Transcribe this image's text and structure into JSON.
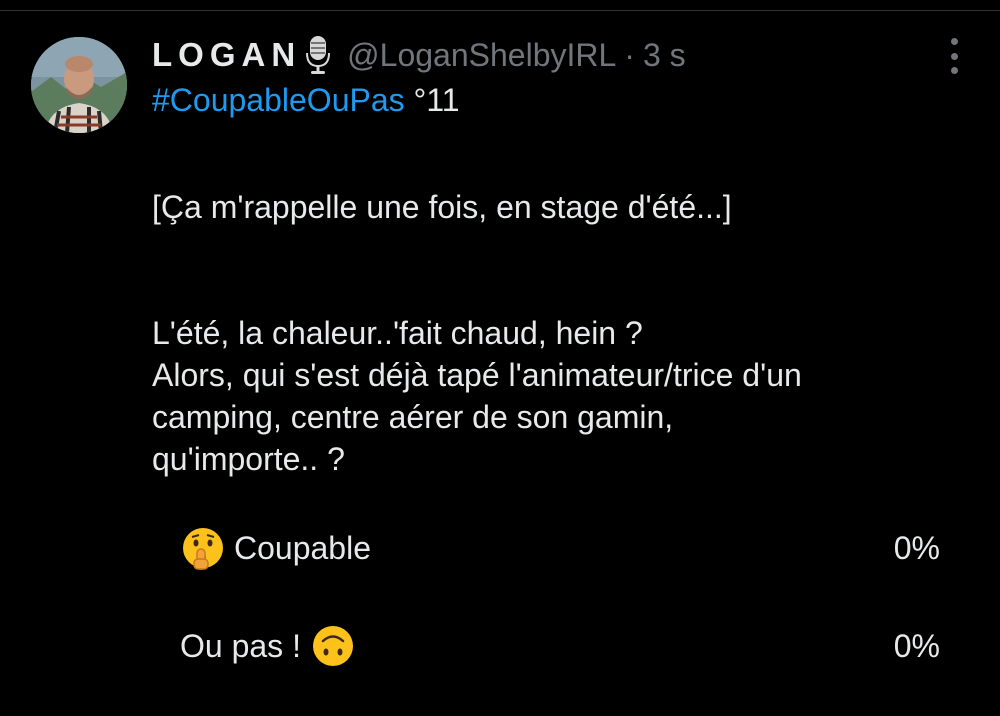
{
  "tweet": {
    "display_name": "LOGAN",
    "name_badge_icon": "microphone-icon",
    "handle": "@LoganShelbyIRL",
    "separator": "·",
    "timestamp": "3 s",
    "more_icon": "more-vertical-icon",
    "hashtag": "#CoupableOuPas",
    "hashtag_suffix": " °11",
    "body": {
      "line1": "[Ça m'rappelle une fois, en stage d'été...]",
      "line2": "L'été, la chaleur..'fait chaud, hein ?",
      "line3": "Alors, qui s'est déjà tapé l'animateur/trice d'un",
      "line4": "camping, centre aérer de son gamin,",
      "line5": "qu'importe.. ?"
    }
  },
  "poll": {
    "options": [
      {
        "label": "Coupable",
        "emoji": "shushing-face-icon",
        "percent": "0%"
      },
      {
        "label": "Ou pas !",
        "emoji": "upside-down-face-icon",
        "percent": "0%"
      }
    ]
  },
  "colors": {
    "background": "#000000",
    "text": "#e7e9ea",
    "muted": "#71767b",
    "link": "#1d9bf0"
  }
}
